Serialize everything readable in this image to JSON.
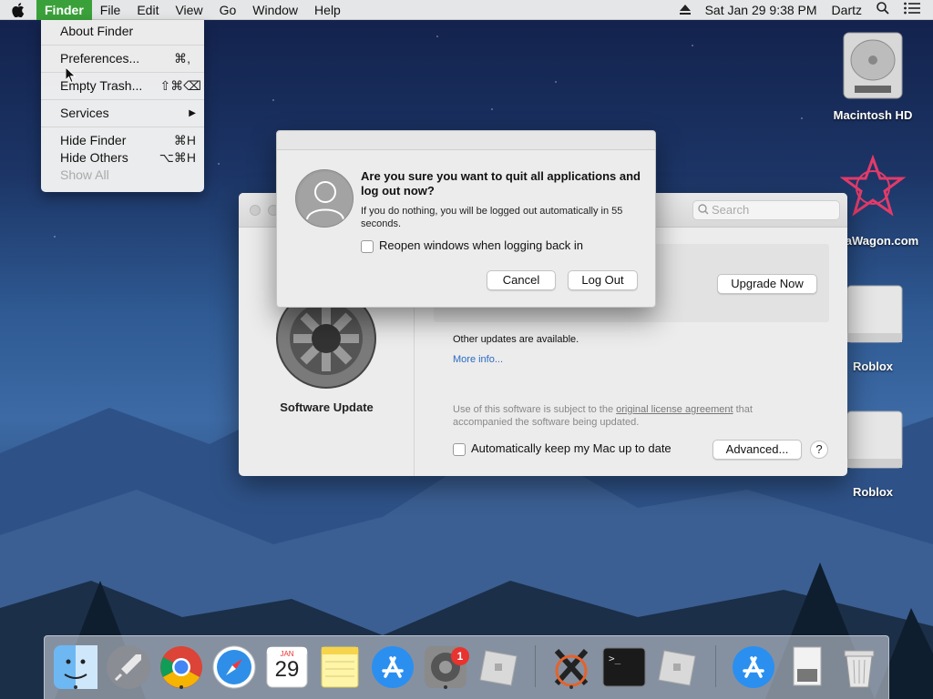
{
  "menubar": {
    "app": "Finder",
    "items": [
      "File",
      "Edit",
      "View",
      "Go",
      "Window",
      "Help"
    ],
    "datetime": "Sat Jan 29  9:38 PM",
    "user": "Dartz"
  },
  "finder_menu": {
    "about": "About Finder",
    "preferences": "Preferences...",
    "preferences_sc": "⌘,",
    "empty_trash": "Empty Trash...",
    "empty_trash_sc": "⇧⌘⌫",
    "services": "Services",
    "services_arrow": "▶",
    "hide_finder": "Hide Finder",
    "hide_finder_sc": "⌘H",
    "hide_others": "Hide Others",
    "hide_others_sc": "⌥⌘H",
    "show_all": "Show All"
  },
  "desktop": {
    "hd": "Macintosh HD",
    "wagon": "aWagon.com",
    "roblox1": "Roblox",
    "roblox2": "Roblox"
  },
  "software_update": {
    "search_placeholder": "Search",
    "name": "Software Update",
    "upgrade_btn": "Upgrade Now",
    "other_updates": "Other updates are available.",
    "more_info": "More info...",
    "license_pre": "Use of this software is subject to the ",
    "license_link": "original license agreement",
    "license_post": " that accompanied the software being updated.",
    "auto_update": "Automatically keep my Mac up to date",
    "advanced_btn": "Advanced...",
    "help_btn": "?"
  },
  "logout_dialog": {
    "title": "Are you sure you want to quit all applications and log out now?",
    "message": "If you do nothing, you will be logged out automatically in 55 seconds.",
    "checkbox_label": "Reopen windows when logging back in",
    "cancel": "Cancel",
    "logout": "Log Out"
  },
  "dock": {
    "calendar_month": "JAN",
    "calendar_day": "29",
    "prefs_badge": "1",
    "terminal_prompt": ">_"
  }
}
